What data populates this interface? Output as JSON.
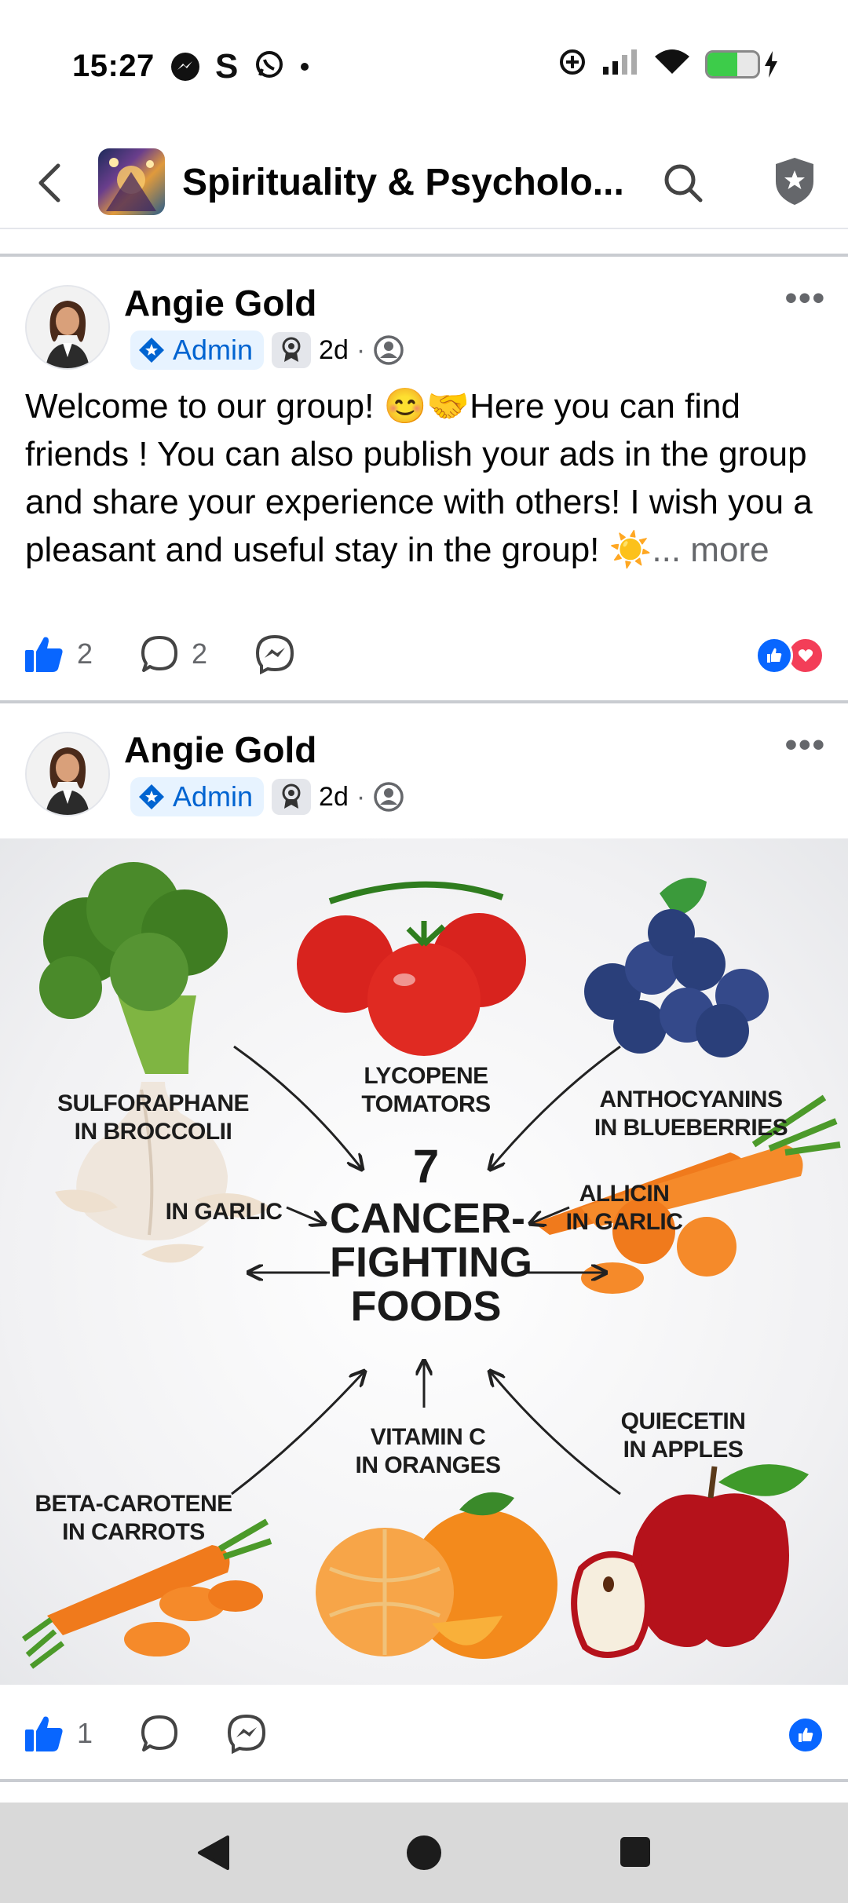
{
  "status_bar": {
    "time": "15:27",
    "icons_left": [
      "messenger-icon",
      "skype-icon",
      "whatsapp-icon",
      "dot-icon"
    ],
    "icons_right": [
      "data-saver-icon",
      "signal-icon",
      "wifi-icon",
      "battery-icon"
    ],
    "battery_level": 0.6
  },
  "header": {
    "title": "Spirituality & Psycholo...",
    "back_icon": "chevron-left-icon",
    "search_icon": "search-icon",
    "admin_icon": "shield-star-icon"
  },
  "posts": [
    {
      "author": "Angie Gold",
      "role": "Admin",
      "age": "2d",
      "separator": "·",
      "text": "Welcome to our group! 😊🤝Here you can find friends ! You can also publish your ads in the group and share your experience with others! I wish you a pleasant and useful stay in the group! ☀️",
      "more": "... more",
      "like_count": "2",
      "comment_count": "2",
      "reactions": [
        "like",
        "love"
      ]
    },
    {
      "author": "Angie Gold",
      "role": "Admin",
      "age": "2d",
      "separator": "·",
      "like_count": "1",
      "reactions": [
        "like"
      ],
      "image": {
        "title_number": "7",
        "title_line1": "CANCER-",
        "title_line2": "FIGHTING",
        "title_line3": "FOODS",
        "labels": {
          "broccoli": "SULFORAPHANE\nIN BROCCOLII",
          "tomatoes": "LYCOPENE\nTOMATORS",
          "blueberries": "ANTHOCYANINS\nIN BLUEBERRIES",
          "garlic_left": "IN GARLIC",
          "garlic_right": "ALLICIN\nIN GARLIC",
          "oranges": "VITAMIN C\nIN ORANGES",
          "apples": "QUIECETIN\nIN APPLES",
          "carrots": "BETA-CAROTENE\nIN CARROTS"
        }
      }
    }
  ]
}
